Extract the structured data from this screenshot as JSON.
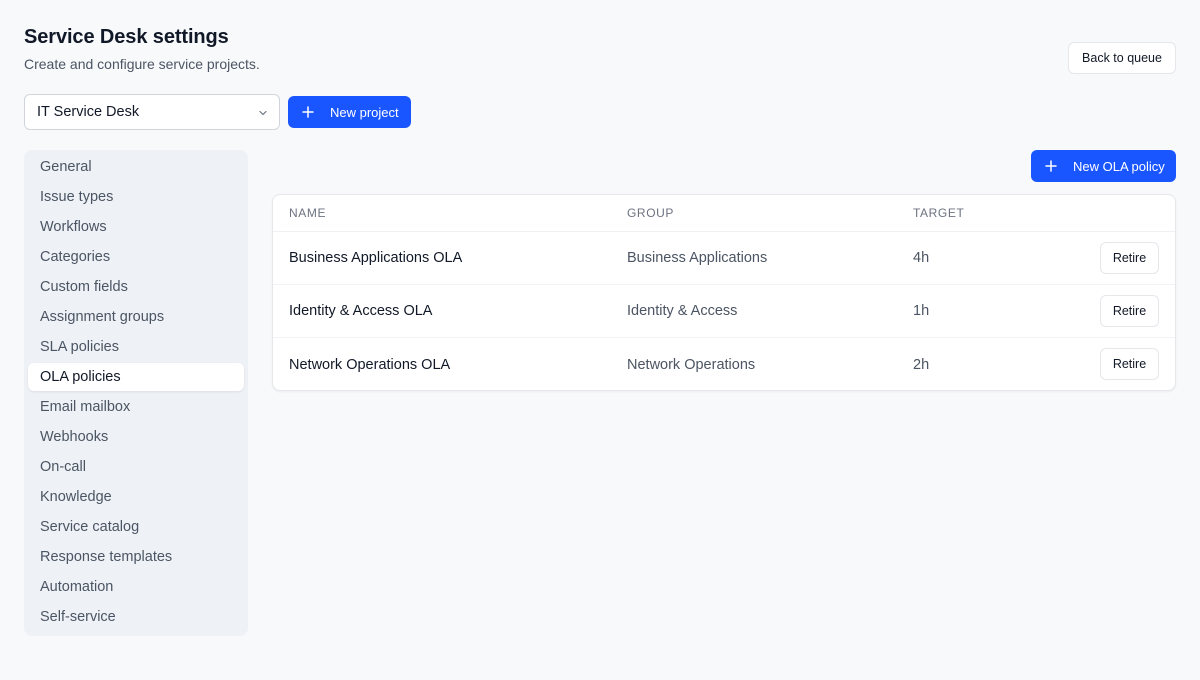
{
  "header": {
    "title": "Service Desk settings",
    "subtitle": "Create and configure service projects.",
    "back_label": "Back to queue"
  },
  "project_select": {
    "selected": "IT Service Desk",
    "icon": "chevron-down-icon"
  },
  "new_project_label": "New project",
  "new_ola_label": "New OLA policy",
  "sidebar": {
    "items": [
      {
        "label": "General"
      },
      {
        "label": "Issue types"
      },
      {
        "label": "Workflows"
      },
      {
        "label": "Categories"
      },
      {
        "label": "Custom fields"
      },
      {
        "label": "Assignment groups"
      },
      {
        "label": "SLA policies"
      },
      {
        "label": "OLA policies",
        "active": true
      },
      {
        "label": "Email mailbox"
      },
      {
        "label": "Webhooks"
      },
      {
        "label": "On-call"
      },
      {
        "label": "Knowledge"
      },
      {
        "label": "Service catalog"
      },
      {
        "label": "Response templates"
      },
      {
        "label": "Automation"
      },
      {
        "label": "Self-service"
      }
    ]
  },
  "table": {
    "columns": {
      "name": "NAME",
      "group": "GROUP",
      "target": "TARGET"
    },
    "rows": [
      {
        "name": "Business Applications OLA",
        "group": "Business Applications",
        "target": "4h",
        "action": "Retire"
      },
      {
        "name": "Identity & Access OLA",
        "group": "Identity & Access",
        "target": "1h",
        "action": "Retire"
      },
      {
        "name": "Network Operations OLA",
        "group": "Network Operations",
        "target": "2h",
        "action": "Retire"
      }
    ]
  },
  "colors": {
    "accent": "#1a56ff",
    "sidebar_bg": "#eef1f6",
    "page_bg": "#f8f9fb"
  }
}
